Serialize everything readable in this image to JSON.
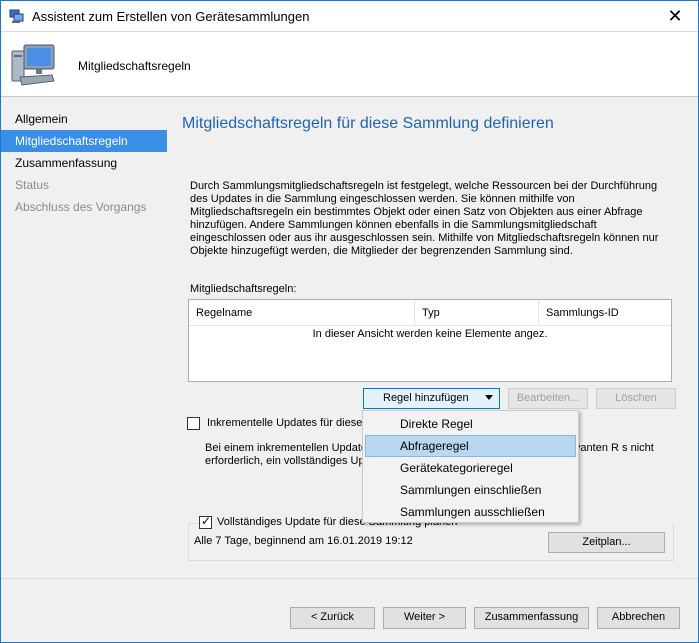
{
  "window": {
    "title": "Assistent zum Erstellen von Gerätesammlungen",
    "close_glyph": "✕"
  },
  "header": {
    "title": "Mitgliedschaftsregeln"
  },
  "nav": {
    "items": [
      {
        "label": "Allgemein",
        "state": "normal"
      },
      {
        "label": "Mitgliedschaftsregeln",
        "state": "active"
      },
      {
        "label": "Zusammenfassung",
        "state": "normal"
      },
      {
        "label": "Status",
        "state": "disabled"
      },
      {
        "label": "Abschluss des Vorgangs",
        "state": "disabled"
      }
    ]
  },
  "main": {
    "title": "Mitgliedschaftsregeln für diese Sammlung definieren",
    "description": "Durch Sammlungsmitgliedschaftsregeln ist festgelegt, welche Ressourcen bei der Durchführung des Updates in die Sammlung eingeschlossen werden. Sie können mithilfe von Mitgliedschaftsregeln ein bestimmtes Objekt oder einen Satz von Objekten aus einer Abfrage hinzufügen. Andere Sammlungen können ebenfalls in die Sammlungsmitgliedschaft eingeschlossen oder aus ihr ausgeschlossen sein. Mithilfe von Mitgliedschaftsregeln können nur Objekte hinzugefügt werden, die Mitglieder der begrenzenden Sammlung sind.",
    "rules_label": "Mitgliedschaftsregeln:",
    "table": {
      "columns": [
        "Regelname",
        "Typ",
        "Sammlungs-ID"
      ],
      "empty_text": "In dieser Ansicht werden keine Elemente angez."
    },
    "buttons": {
      "add_rule": "Regel hinzufügen",
      "edit": "Bearbeiten...",
      "delete": "Löschen",
      "schedule": "Zeitplan..."
    },
    "incremental": {
      "label": "Inkrementelle Updates für diese S",
      "checked": false,
      "description": "Bei einem inkrementellen Update                                                                    rtet und dann die für diese Sammlung relevanten R                                                               s nicht erforderlich, ein vollständiges Update für die S"
    },
    "full_update": {
      "label": "Vollständiges Update für diese Sammlung planen",
      "checked": true,
      "schedule_text": "Alle 7 Tage, beginnend am 16.01.2019 19:12"
    }
  },
  "dropdown": {
    "items": [
      {
        "label": "Direkte Regel",
        "hover": false
      },
      {
        "label": "Abfrageregel",
        "hover": true
      },
      {
        "label": "Gerätekategorieregel",
        "hover": false
      },
      {
        "label": "Sammlungen einschließen",
        "hover": false
      },
      {
        "label": "Sammlungen ausschließen",
        "hover": false
      }
    ]
  },
  "footer": {
    "back": "< Zurück",
    "next": "Weiter >",
    "summary": "Zusammenfassung",
    "cancel": "Abbrechen"
  },
  "colors": {
    "accent": "#1e64b4",
    "nav_active": "#3a8ee6",
    "menu_hover": "#b9d7f1"
  }
}
